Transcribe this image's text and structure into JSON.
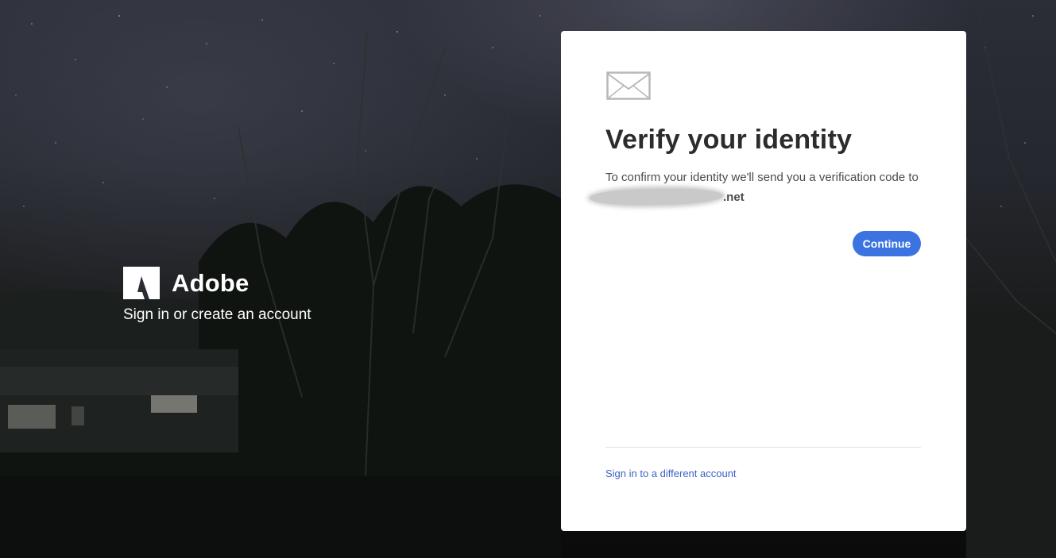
{
  "brand": {
    "name": "Adobe",
    "tagline": "Sign in or create an account",
    "logo_icon": "adobe-logo-icon"
  },
  "card": {
    "icon": "mail-icon",
    "title": "Verify your identity",
    "message": "To confirm your identity we'll send you a verification code to",
    "email_visible_part": ".net",
    "continue_label": "Continue",
    "switch_account_label": "Sign in to a different account"
  },
  "colors": {
    "accent": "#3b73e0",
    "link": "#3b63c4",
    "title": "#2c2c2c",
    "card_background": "#ffffff"
  }
}
